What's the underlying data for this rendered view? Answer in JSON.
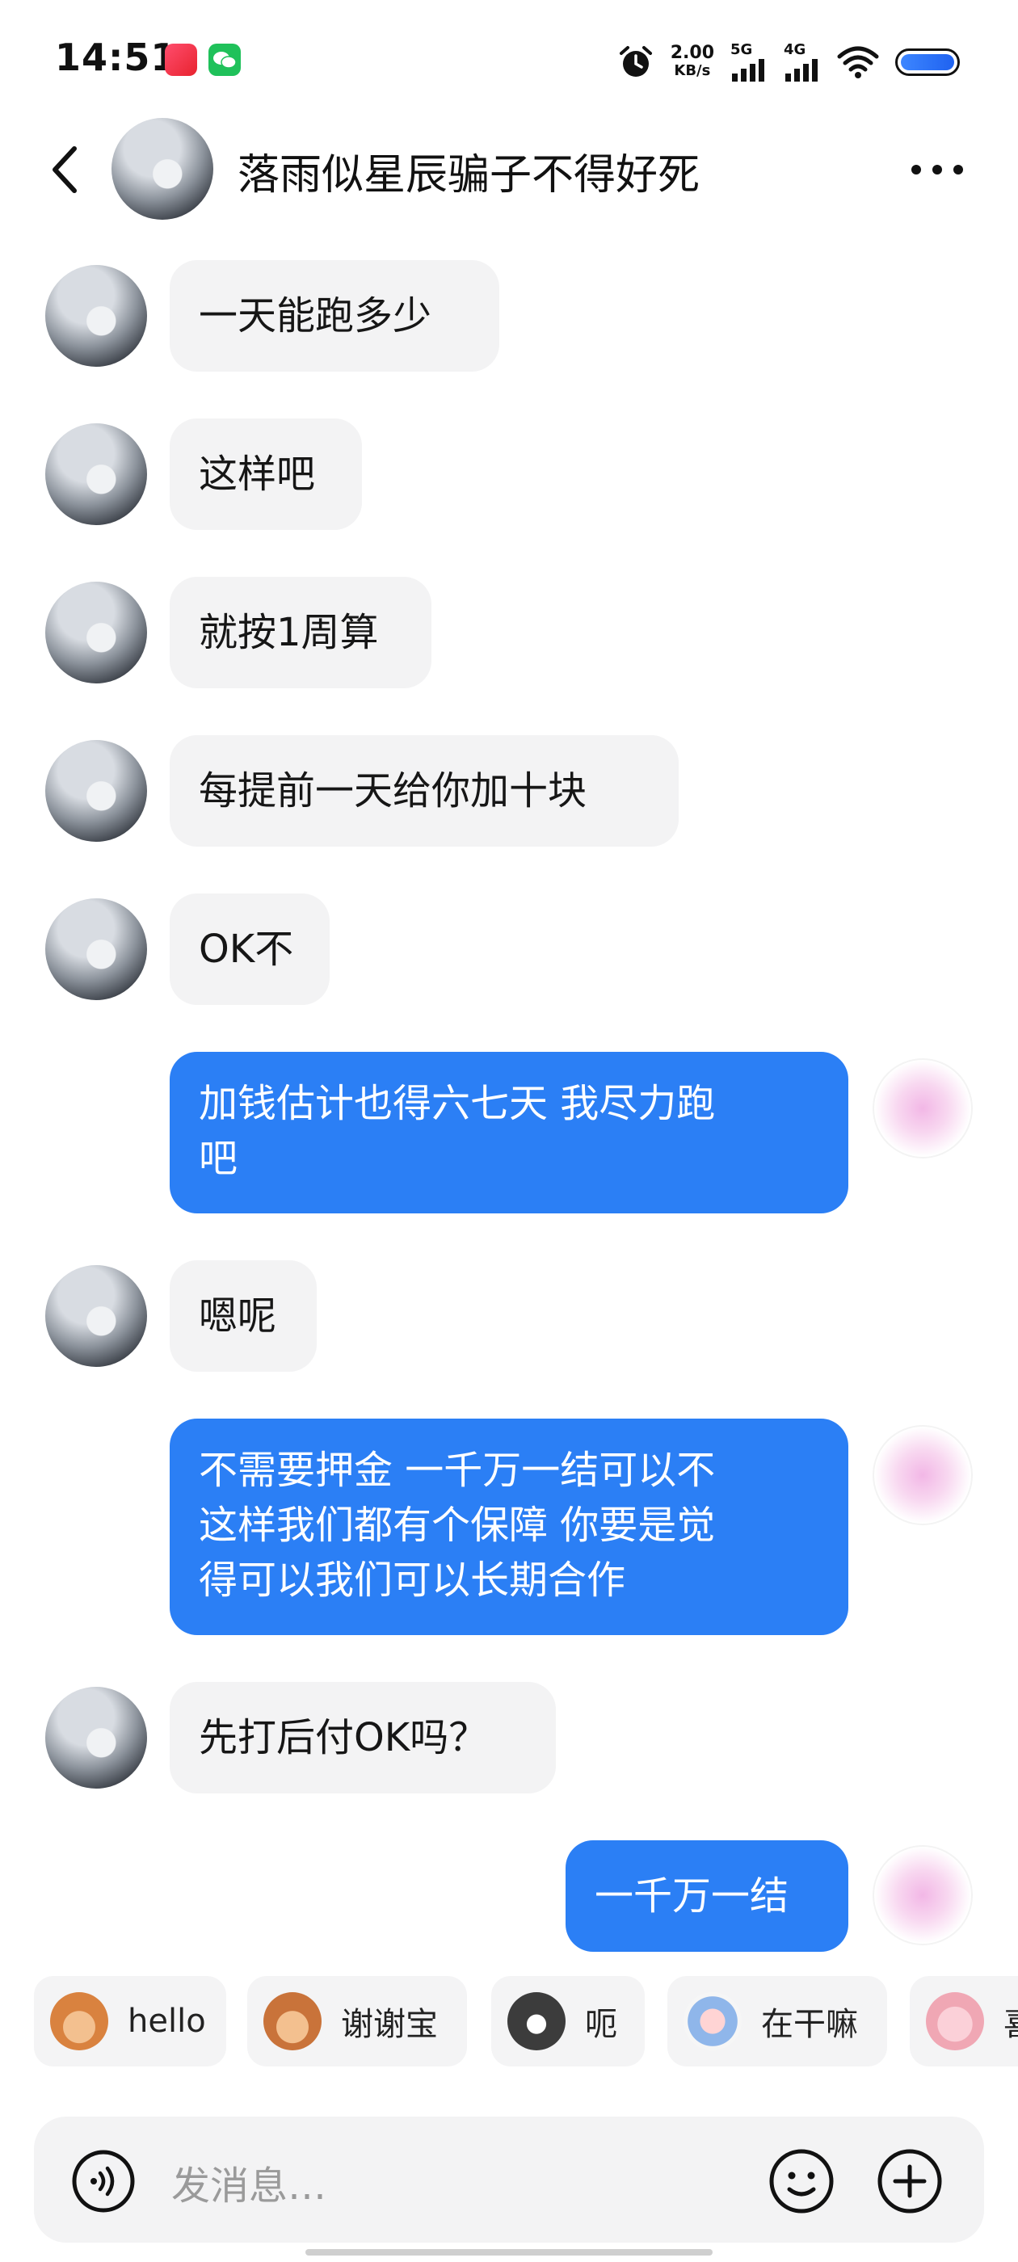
{
  "status_bar": {
    "time": "14:51",
    "speed_value": "2.00",
    "speed_unit": "KB/s",
    "signal1_label": "5G",
    "signal2_label": "4G"
  },
  "header": {
    "contact_name": "落雨似星辰骗子不得好死"
  },
  "messages": [
    {
      "side": "in",
      "text": "一天能跑多少"
    },
    {
      "side": "in",
      "text": "这样吧"
    },
    {
      "side": "in",
      "text": "就按1周算"
    },
    {
      "side": "in",
      "text": "每提前一天给你加十块"
    },
    {
      "side": "in",
      "text": "OK不"
    },
    {
      "side": "out",
      "text": "加钱估计也得六七天 我尽力跑\n吧"
    },
    {
      "side": "in",
      "text": "嗯呢"
    },
    {
      "side": "out",
      "text": "不需要押金 一千万一结可以不\n这样我们都有个保障 你要是觉\n得可以我们可以长期合作"
    },
    {
      "side": "in",
      "text": "先打后付OK吗？"
    },
    {
      "side": "out",
      "text": "一千万一结"
    }
  ],
  "stickers": [
    {
      "label": "hello",
      "color": "#e08a4c"
    },
    {
      "label": "谢谢宝",
      "color": "#d9804a"
    },
    {
      "label": "呃",
      "color": "#3c3c3c"
    },
    {
      "label": "在干嘛",
      "color": "#e86b6b"
    },
    {
      "label": "喜",
      "color": "#f1a5b5"
    }
  ],
  "input": {
    "placeholder": "发消息…"
  },
  "colors": {
    "outgoing_bubble": "#2b7ff5",
    "incoming_bubble": "#f3f3f4"
  }
}
